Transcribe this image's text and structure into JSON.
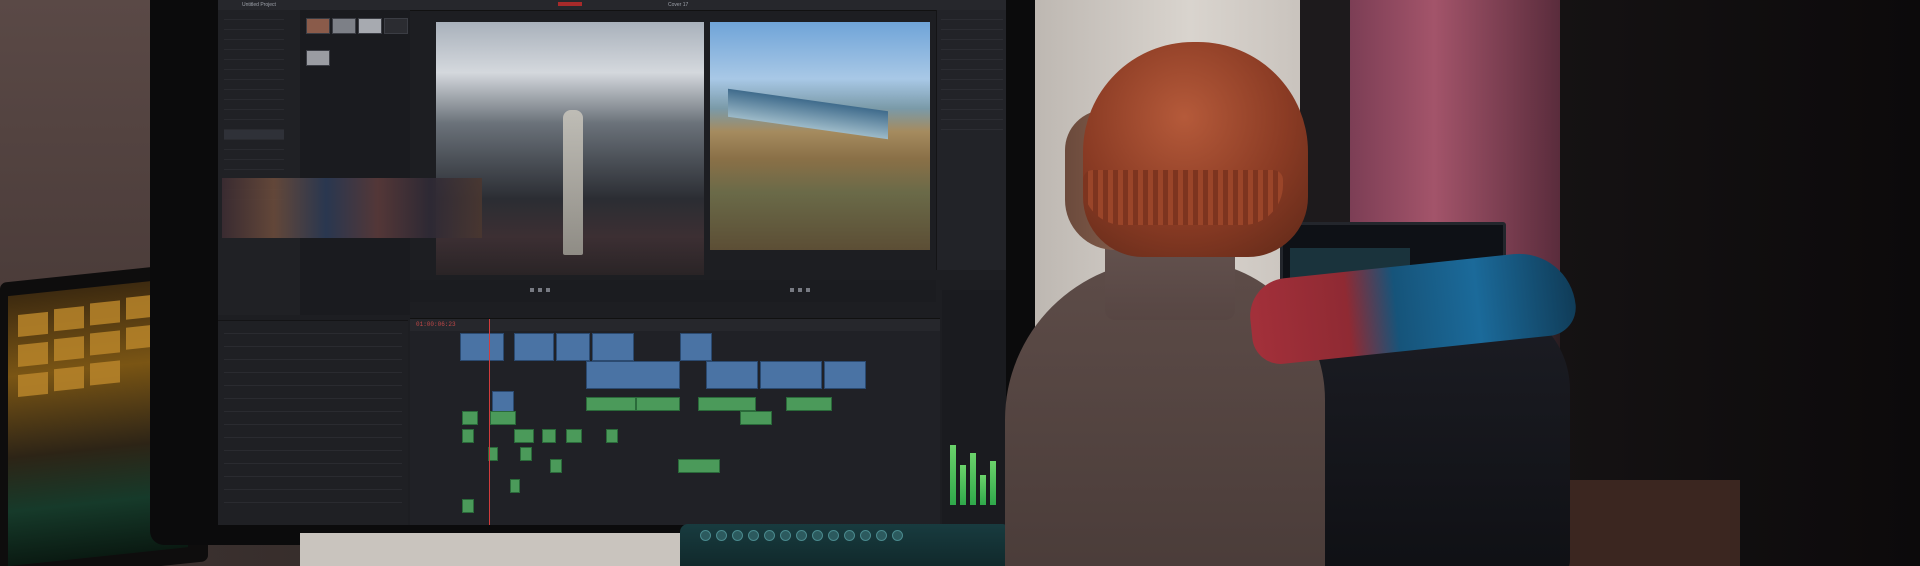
{
  "scene": {
    "description_tag": "photo-video-editing-workstation"
  },
  "editor_app": {
    "window_title": "Untitled Project",
    "project_name": "Cover 17",
    "timecode": "01:00:06:23",
    "accent_colors": {
      "video_clip": "#4a73a4",
      "audio_clip": "#4b9a5a",
      "playhead": "#d23c3c"
    }
  }
}
